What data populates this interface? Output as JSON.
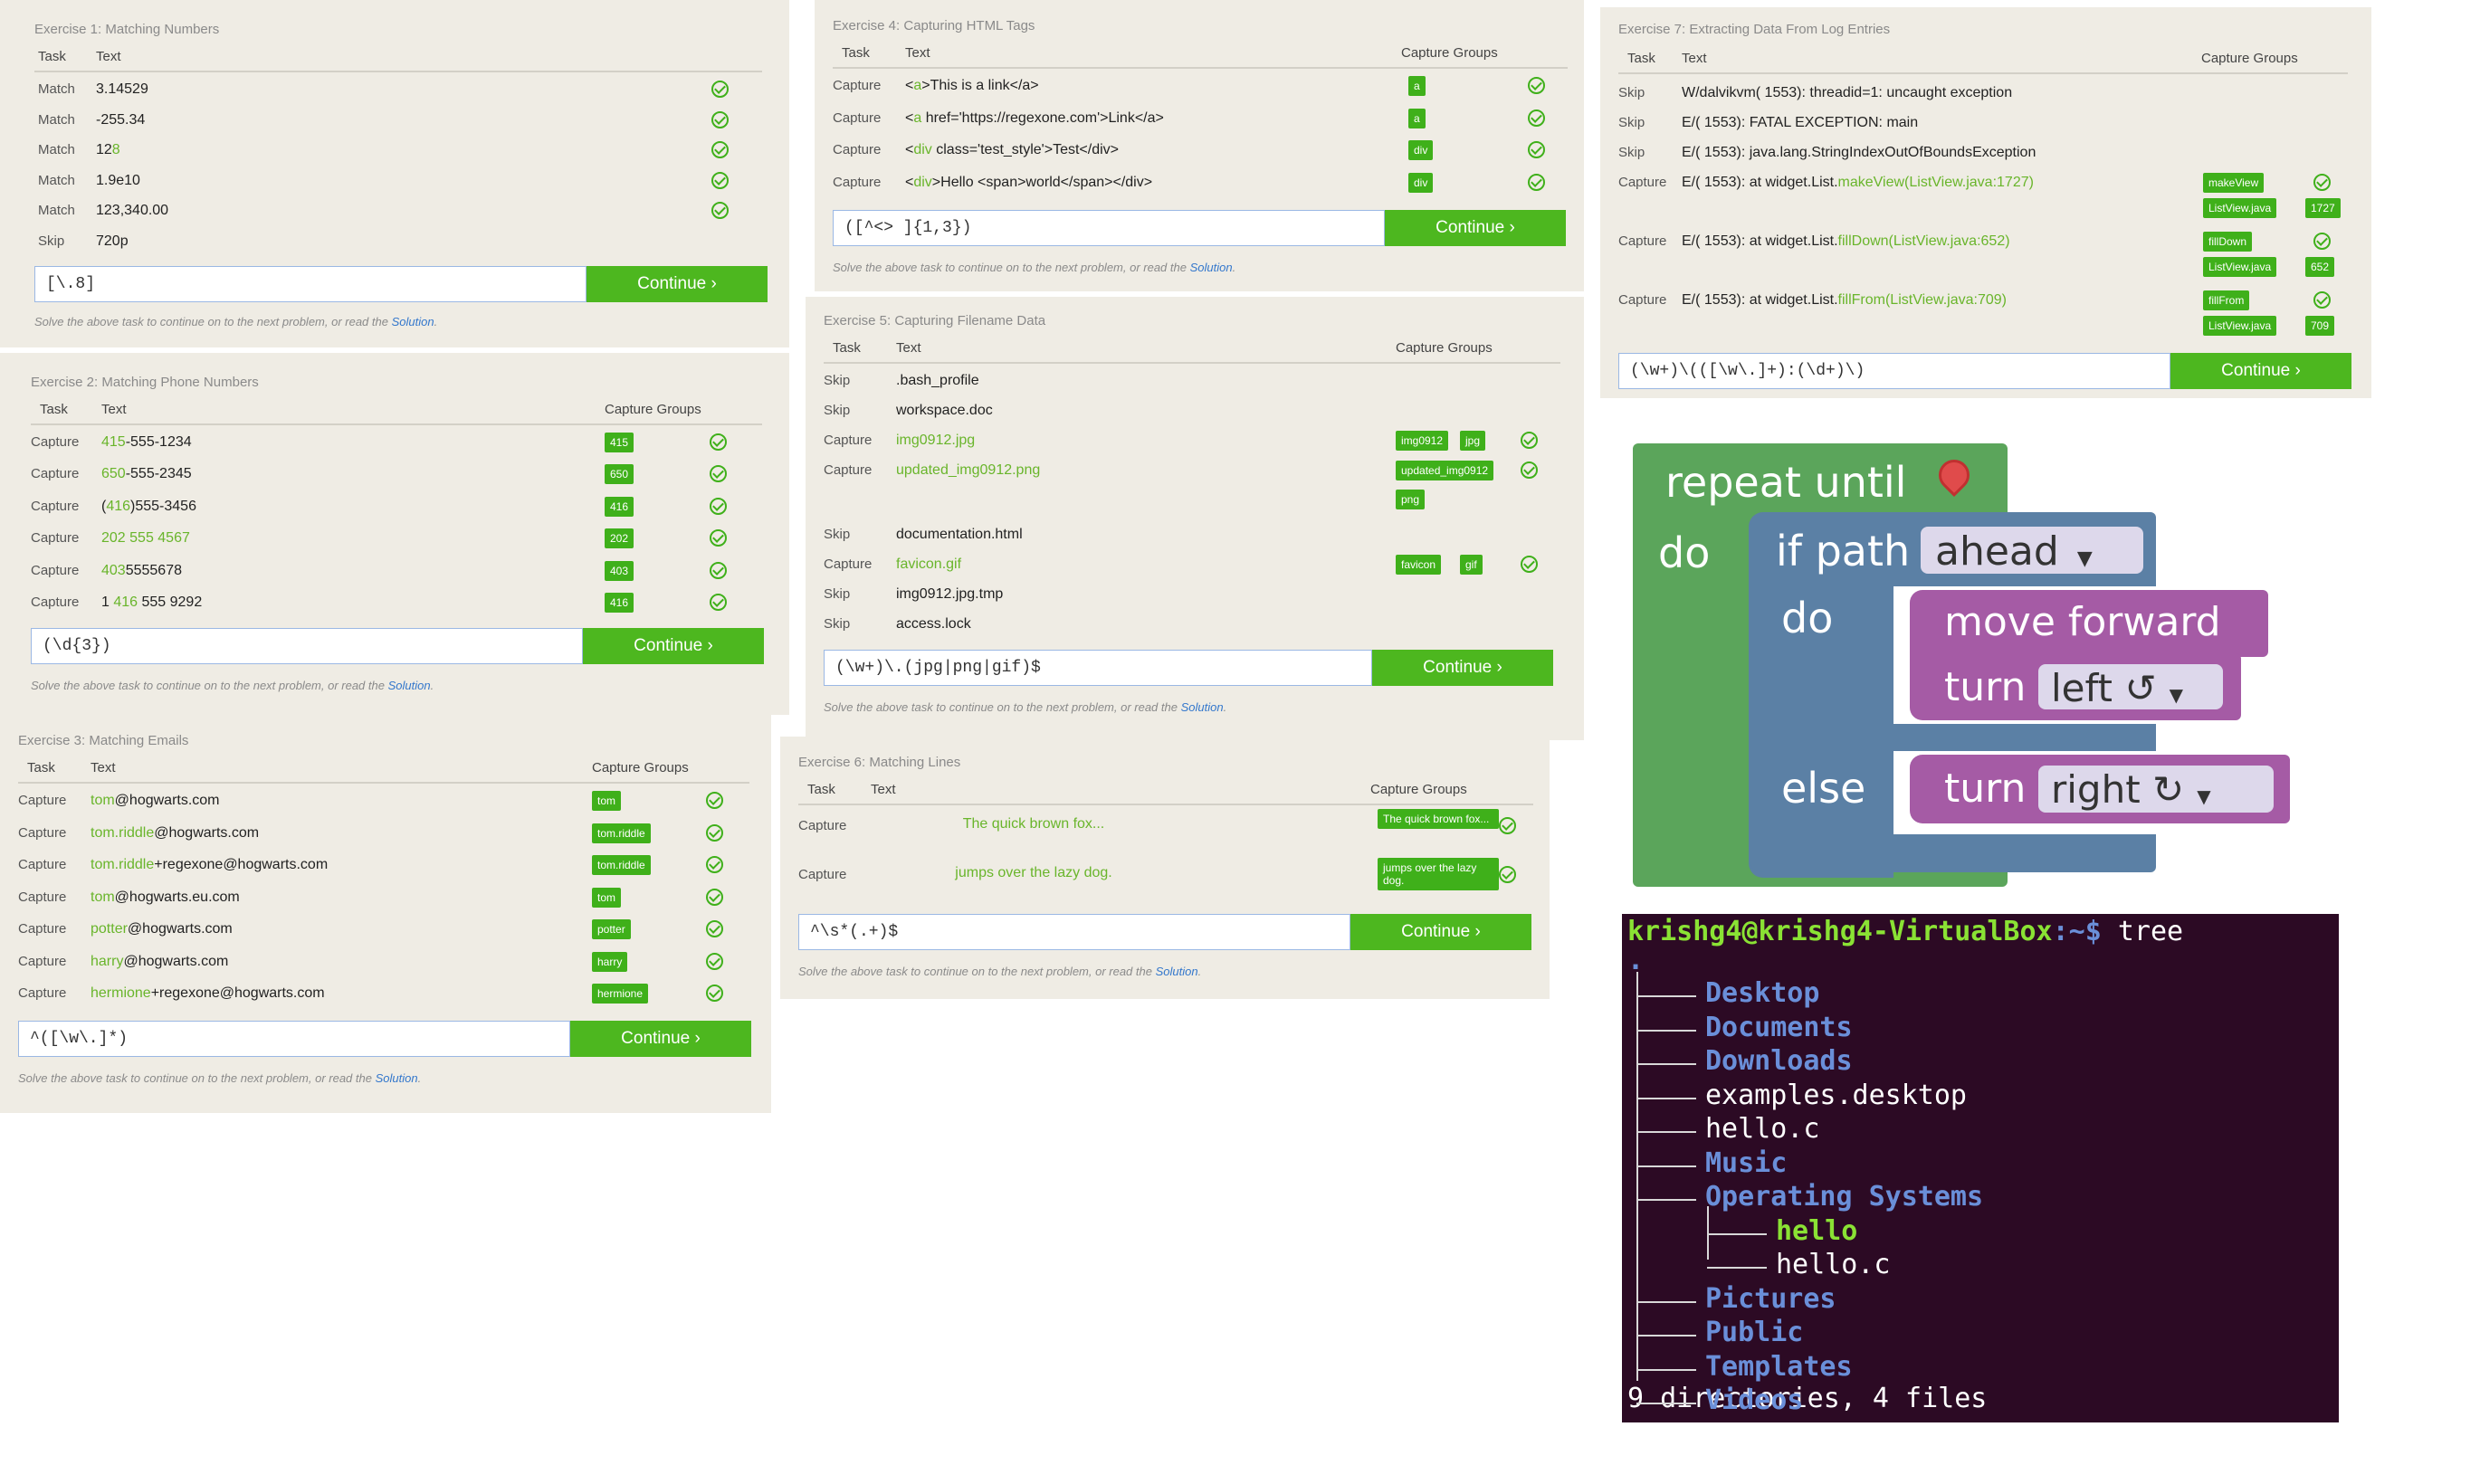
{
  "common": {
    "continue_label": "Continue ›",
    "hint_prefix": "Solve the above task to continue on to the next problem, or read the ",
    "hint_link": "Solution",
    "hint_suffix": ".",
    "col_task": "Task",
    "col_text": "Text",
    "col_groups": "Capture Groups"
  },
  "ex1": {
    "title": "Exercise 1: Matching Numbers",
    "rows": [
      {
        "task": "Match",
        "pre": "3.14529",
        "hl": "",
        "post": ""
      },
      {
        "task": "Match",
        "pre": "-255.34",
        "hl": "",
        "post": ""
      },
      {
        "task": "Match",
        "pre": "12",
        "hl": "8",
        "post": ""
      },
      {
        "task": "Match",
        "pre": "1.9e10",
        "hl": "",
        "post": ""
      },
      {
        "task": "Match",
        "pre": "123,340.00",
        "hl": "",
        "post": ""
      },
      {
        "task": "Skip",
        "pre": "720p",
        "hl": "",
        "post": ""
      }
    ],
    "input": "[\\.8]"
  },
  "ex2": {
    "title": "Exercise 2: Matching Phone Numbers",
    "rows": [
      {
        "task": "Capture",
        "pre": "",
        "hl": "415",
        "post": "-555-1234",
        "groups": [
          "415"
        ]
      },
      {
        "task": "Capture",
        "pre": "",
        "hl": "650",
        "post": "-555-2345",
        "groups": [
          "650"
        ]
      },
      {
        "task": "Capture",
        "pre": "(",
        "hl": "416",
        "post": ")555-3456",
        "groups": [
          "416"
        ]
      },
      {
        "task": "Capture",
        "pre": "",
        "hl": "202 555 4567",
        "post": "",
        "groups": [
          "202"
        ]
      },
      {
        "task": "Capture",
        "pre": "",
        "hl": "403",
        "post": "5555678",
        "groups": [
          "403"
        ]
      },
      {
        "task": "Capture",
        "pre": "1 ",
        "hl": "416",
        "post": " 555 9292",
        "groups": [
          "416"
        ]
      }
    ],
    "input": "(\\d{3})"
  },
  "ex3": {
    "title": "Exercise 3: Matching Emails",
    "rows": [
      {
        "task": "Capture",
        "pre": "",
        "hl": "tom",
        "post": "@hogwarts.com",
        "groups": [
          "tom"
        ]
      },
      {
        "task": "Capture",
        "pre": "",
        "hl": "tom.riddle",
        "post": "@hogwarts.com",
        "groups": [
          "tom.riddle"
        ]
      },
      {
        "task": "Capture",
        "pre": "",
        "hl": "tom.riddle",
        "post": "+regexone@hogwarts.com",
        "groups": [
          "tom.riddle"
        ]
      },
      {
        "task": "Capture",
        "pre": "",
        "hl": "tom",
        "post": "@hogwarts.eu.com",
        "groups": [
          "tom"
        ]
      },
      {
        "task": "Capture",
        "pre": "",
        "hl": "potter",
        "post": "@hogwarts.com",
        "groups": [
          "potter"
        ]
      },
      {
        "task": "Capture",
        "pre": "",
        "hl": "harry",
        "post": "@hogwarts.com",
        "groups": [
          "harry"
        ]
      },
      {
        "task": "Capture",
        "pre": "",
        "hl": "hermione",
        "post": "+regexone@hogwarts.com",
        "groups": [
          "hermione"
        ]
      }
    ],
    "input": "^([\\w\\.]*)"
  },
  "ex4": {
    "title": "Exercise 4: Capturing HTML Tags",
    "rows": [
      {
        "task": "Capture",
        "pre": "<",
        "hl": "a",
        "post": ">This is a link</a>",
        "groups": [
          "a"
        ]
      },
      {
        "task": "Capture",
        "pre": "<",
        "hl": "a",
        "post": " href='https://regexone.com'>Link</a>",
        "groups": [
          "a"
        ]
      },
      {
        "task": "Capture",
        "pre": "<",
        "hl": "div",
        "post": " class='test_style'>Test</div>",
        "groups": [
          "div"
        ]
      },
      {
        "task": "Capture",
        "pre": "<",
        "hl": "div",
        "post": ">Hello <span>world</span></div>",
        "groups": [
          "div"
        ]
      }
    ],
    "input": "([^<> ]{1,3})"
  },
  "ex5": {
    "title": "Exercise 5: Capturing Filename Data",
    "rows": [
      {
        "task": "Skip",
        "pre": ".bash_profile",
        "hl": "",
        "post": "",
        "groups": []
      },
      {
        "task": "Skip",
        "pre": "workspace.doc",
        "hl": "",
        "post": "",
        "groups": []
      },
      {
        "task": "Capture",
        "pre": "",
        "hl": "img0912.jpg",
        "post": "",
        "groups": [
          "img0912",
          "jpg"
        ]
      },
      {
        "task": "Capture",
        "pre": "",
        "hl": "updated_img0912.png",
        "post": "",
        "groups": [
          "updated_img0912",
          "png"
        ]
      },
      {
        "task": "Skip",
        "pre": "documentation.html",
        "hl": "",
        "post": "",
        "groups": []
      },
      {
        "task": "Capture",
        "pre": "",
        "hl": "favicon.gif",
        "post": "",
        "groups": [
          "favicon",
          "gif"
        ]
      },
      {
        "task": "Skip",
        "pre": "img0912.jpg.tmp",
        "hl": "",
        "post": "",
        "groups": []
      },
      {
        "task": "Skip",
        "pre": "access.lock",
        "hl": "",
        "post": "",
        "groups": []
      }
    ],
    "input": "(\\w+)\\.(jpg|png|gif)$"
  },
  "ex6": {
    "title": "Exercise 6: Matching Lines",
    "rows": [
      {
        "task": "Capture",
        "pre": "",
        "hl": "The quick brown fox...",
        "post": "",
        "groups": [
          "The quick brown fox..."
        ]
      },
      {
        "task": "Capture",
        "pre": "",
        "hl": "jumps over the lazy dog.",
        "post": "",
        "groups": [
          "jumps over the lazy dog."
        ]
      }
    ],
    "input": "^\\s*(.+)$"
  },
  "ex7": {
    "title": "Exercise 7: Extracting Data From Log Entries",
    "rows": [
      {
        "task": "Skip",
        "pre": "W/dalvikvm( 1553): threadid=1: uncaught exception",
        "hl": "",
        "post": "",
        "groups": []
      },
      {
        "task": "Skip",
        "pre": "E/( 1553): FATAL EXCEPTION: main",
        "hl": "",
        "post": "",
        "groups": []
      },
      {
        "task": "Skip",
        "pre": "E/( 1553): java.lang.StringIndexOutOfBoundsException",
        "hl": "",
        "post": "",
        "groups": []
      },
      {
        "task": "Capture",
        "pre": "E/( 1553):    at widget.List.",
        "hl": "makeView(ListView.java:1727)",
        "post": "",
        "groups": [
          "makeView",
          "ListView.java",
          "1727"
        ]
      },
      {
        "task": "Capture",
        "pre": "E/( 1553):    at widget.List.",
        "hl": "fillDown(ListView.java:652)",
        "post": "",
        "groups": [
          "fillDown",
          "ListView.java",
          "652"
        ]
      },
      {
        "task": "Capture",
        "pre": "E/( 1553):    at widget.List.",
        "hl": "fillFrom(ListView.java:709)",
        "post": "",
        "groups": [
          "fillFrom",
          "ListView.java",
          "709"
        ]
      }
    ],
    "input": "(\\w+)\\(([\\w\\.]+):(\\d+)\\)"
  },
  "blockly": {
    "repeat_until": "repeat until",
    "do1": "do",
    "if_path": "if path",
    "ahead": "ahead",
    "do2": "do",
    "move_forward": "move forward",
    "turn1": "turn",
    "left": "left ↺",
    "else": "else",
    "turn2": "turn",
    "right": "right ↻",
    "colors": {
      "loop": "#5ba55b",
      "logic": "#5b80a5",
      "action": "#a55ba5"
    }
  },
  "terminal": {
    "prompt": "krishg4@krishg4-VirtualBox",
    "prompt_path": ":~$",
    "command": " tree",
    "root": ".",
    "items": [
      {
        "name": "Desktop",
        "kind": "dir"
      },
      {
        "name": "Documents",
        "kind": "dir"
      },
      {
        "name": "Downloads",
        "kind": "dir"
      },
      {
        "name": "examples.desktop",
        "kind": "file"
      },
      {
        "name": "hello.c",
        "kind": "file"
      },
      {
        "name": "Music",
        "kind": "dir"
      },
      {
        "name": "Operating Systems",
        "kind": "dir"
      },
      {
        "name": "hello",
        "kind": "exe"
      },
      {
        "name": "hello.c",
        "kind": "file"
      },
      {
        "name": "Pictures",
        "kind": "dir"
      },
      {
        "name": "Public",
        "kind": "dir"
      },
      {
        "name": "Templates",
        "kind": "dir"
      },
      {
        "name": "Videos",
        "kind": "dir"
      }
    ],
    "summary": "9 directories, 4 files"
  }
}
